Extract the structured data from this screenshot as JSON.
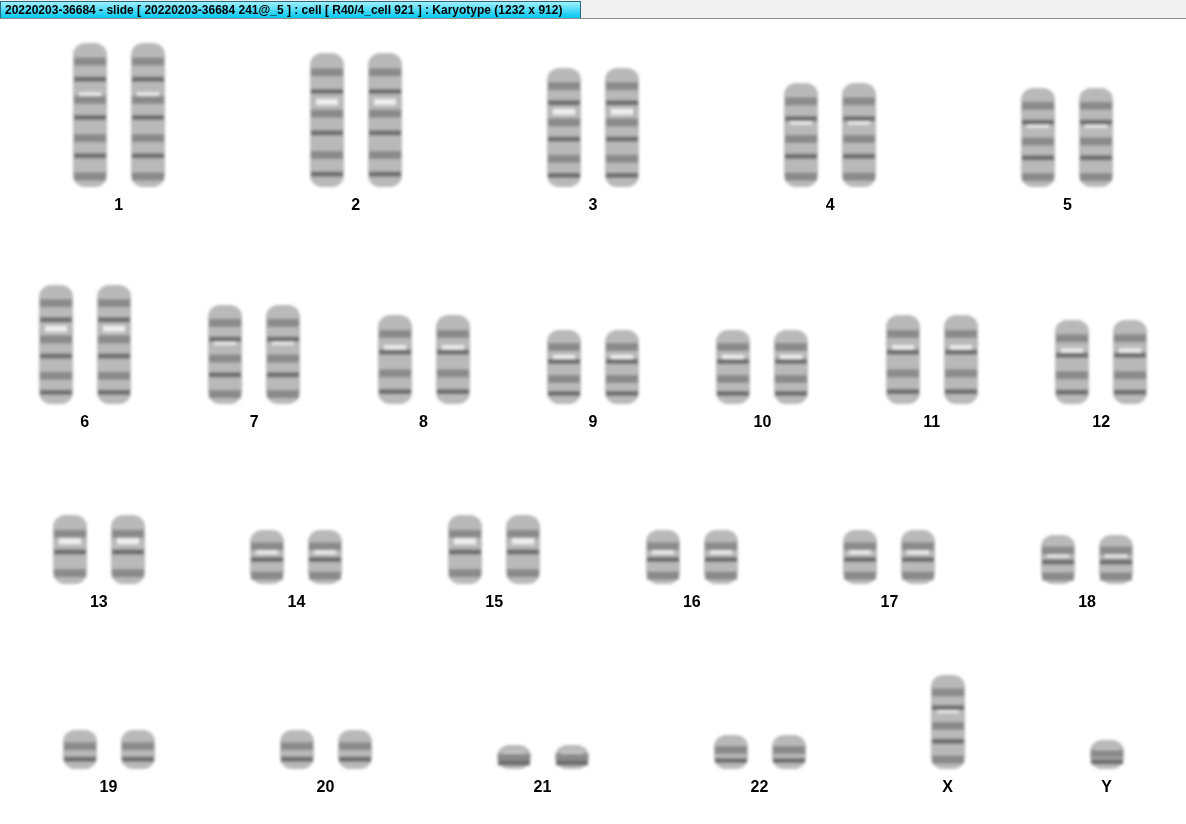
{
  "window": {
    "title": "20220203-36684 - slide [ 20220203-36684 241@_5 ] : cell [ R40/4_cell 921 ] : Karyotype  (1232 x 912)"
  },
  "karyotype_rows": [
    {
      "chromosomes": [
        {
          "label": "1",
          "kind": "pair"
        },
        {
          "label": "2",
          "kind": "pair"
        },
        {
          "label": "3",
          "kind": "pair"
        },
        {
          "label": "4",
          "kind": "pair"
        },
        {
          "label": "5",
          "kind": "pair"
        }
      ]
    },
    {
      "chromosomes": [
        {
          "label": "6",
          "kind": "pair"
        },
        {
          "label": "7",
          "kind": "pair"
        },
        {
          "label": "8",
          "kind": "pair"
        },
        {
          "label": "9",
          "kind": "pair"
        },
        {
          "label": "10",
          "kind": "pair"
        },
        {
          "label": "11",
          "kind": "pair"
        },
        {
          "label": "12",
          "kind": "pair"
        }
      ]
    },
    {
      "chromosomes": [
        {
          "label": "13",
          "kind": "pair"
        },
        {
          "label": "14",
          "kind": "pair"
        },
        {
          "label": "15",
          "kind": "pair"
        },
        {
          "label": "16",
          "kind": "pair"
        },
        {
          "label": "17",
          "kind": "pair"
        },
        {
          "label": "18",
          "kind": "pair"
        }
      ]
    },
    {
      "chromosomes": [
        {
          "label": "19",
          "kind": "pair"
        },
        {
          "label": "20",
          "kind": "pair"
        },
        {
          "label": "21",
          "kind": "pair"
        },
        {
          "label": "22",
          "kind": "pair"
        },
        {
          "label": "X",
          "kind": "single"
        },
        {
          "label": "Y",
          "kind": "single"
        }
      ]
    }
  ]
}
